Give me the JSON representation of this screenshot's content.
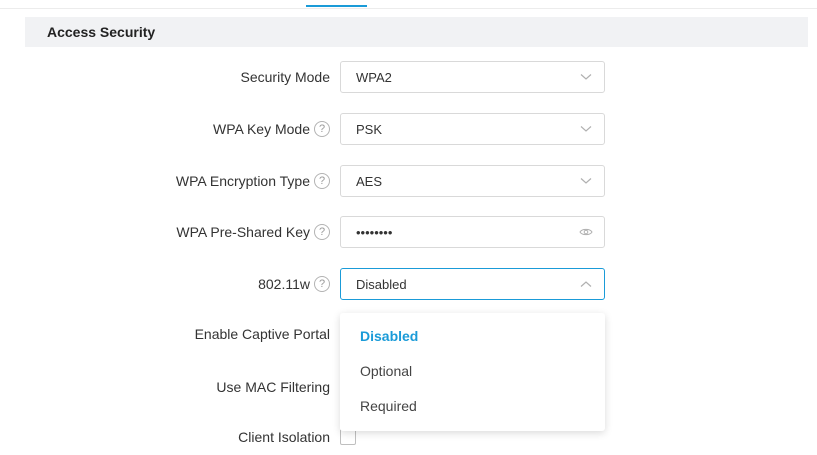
{
  "section": {
    "title": "Access Security"
  },
  "fields": {
    "security_mode": {
      "label": "Security Mode",
      "value": "WPA2"
    },
    "wpa_key_mode": {
      "label": "WPA Key Mode",
      "value": "PSK"
    },
    "wpa_encryption_type": {
      "label": "WPA Encryption Type",
      "value": "AES"
    },
    "wpa_pre_shared_key": {
      "label": "WPA Pre-Shared Key",
      "value": "••••••••"
    },
    "dot11w": {
      "label": "802.11w",
      "value": "Disabled"
    },
    "enable_captive_portal": {
      "label": "Enable Captive Portal"
    },
    "use_mac_filtering": {
      "label": "Use MAC Filtering"
    },
    "client_isolation": {
      "label": "Client Isolation"
    }
  },
  "dropdown": {
    "options": [
      "Disabled",
      "Optional",
      "Required"
    ],
    "selected": "Disabled"
  },
  "icons": {
    "help": "question-circle-icon",
    "chevron_down": "chevron-down-icon",
    "chevron_up": "chevron-up-icon",
    "eye": "eye-icon"
  },
  "colors": {
    "accent": "#1a9bd8",
    "section_bg": "#f1f2f4"
  },
  "help_glyph": "?"
}
